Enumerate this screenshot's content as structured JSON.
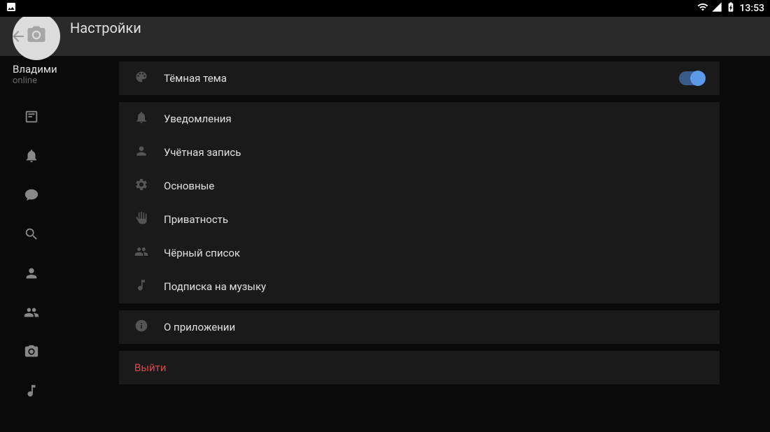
{
  "statusbar": {
    "time": "13:53"
  },
  "header": {
    "title": "Настройки"
  },
  "user": {
    "name": "Владими",
    "status": "online"
  },
  "settings": {
    "dark_theme": {
      "label": "Тёмная тема",
      "enabled": true
    },
    "notifications": {
      "label": "Уведомления"
    },
    "account": {
      "label": "Учётная запись"
    },
    "general": {
      "label": "Основные"
    },
    "privacy": {
      "label": "Приватность"
    },
    "blacklist": {
      "label": "Чёрный список"
    },
    "music_subscription": {
      "label": "Подписка на музыку"
    },
    "about": {
      "label": "О приложении"
    },
    "logout": {
      "label": "Выйти"
    }
  }
}
